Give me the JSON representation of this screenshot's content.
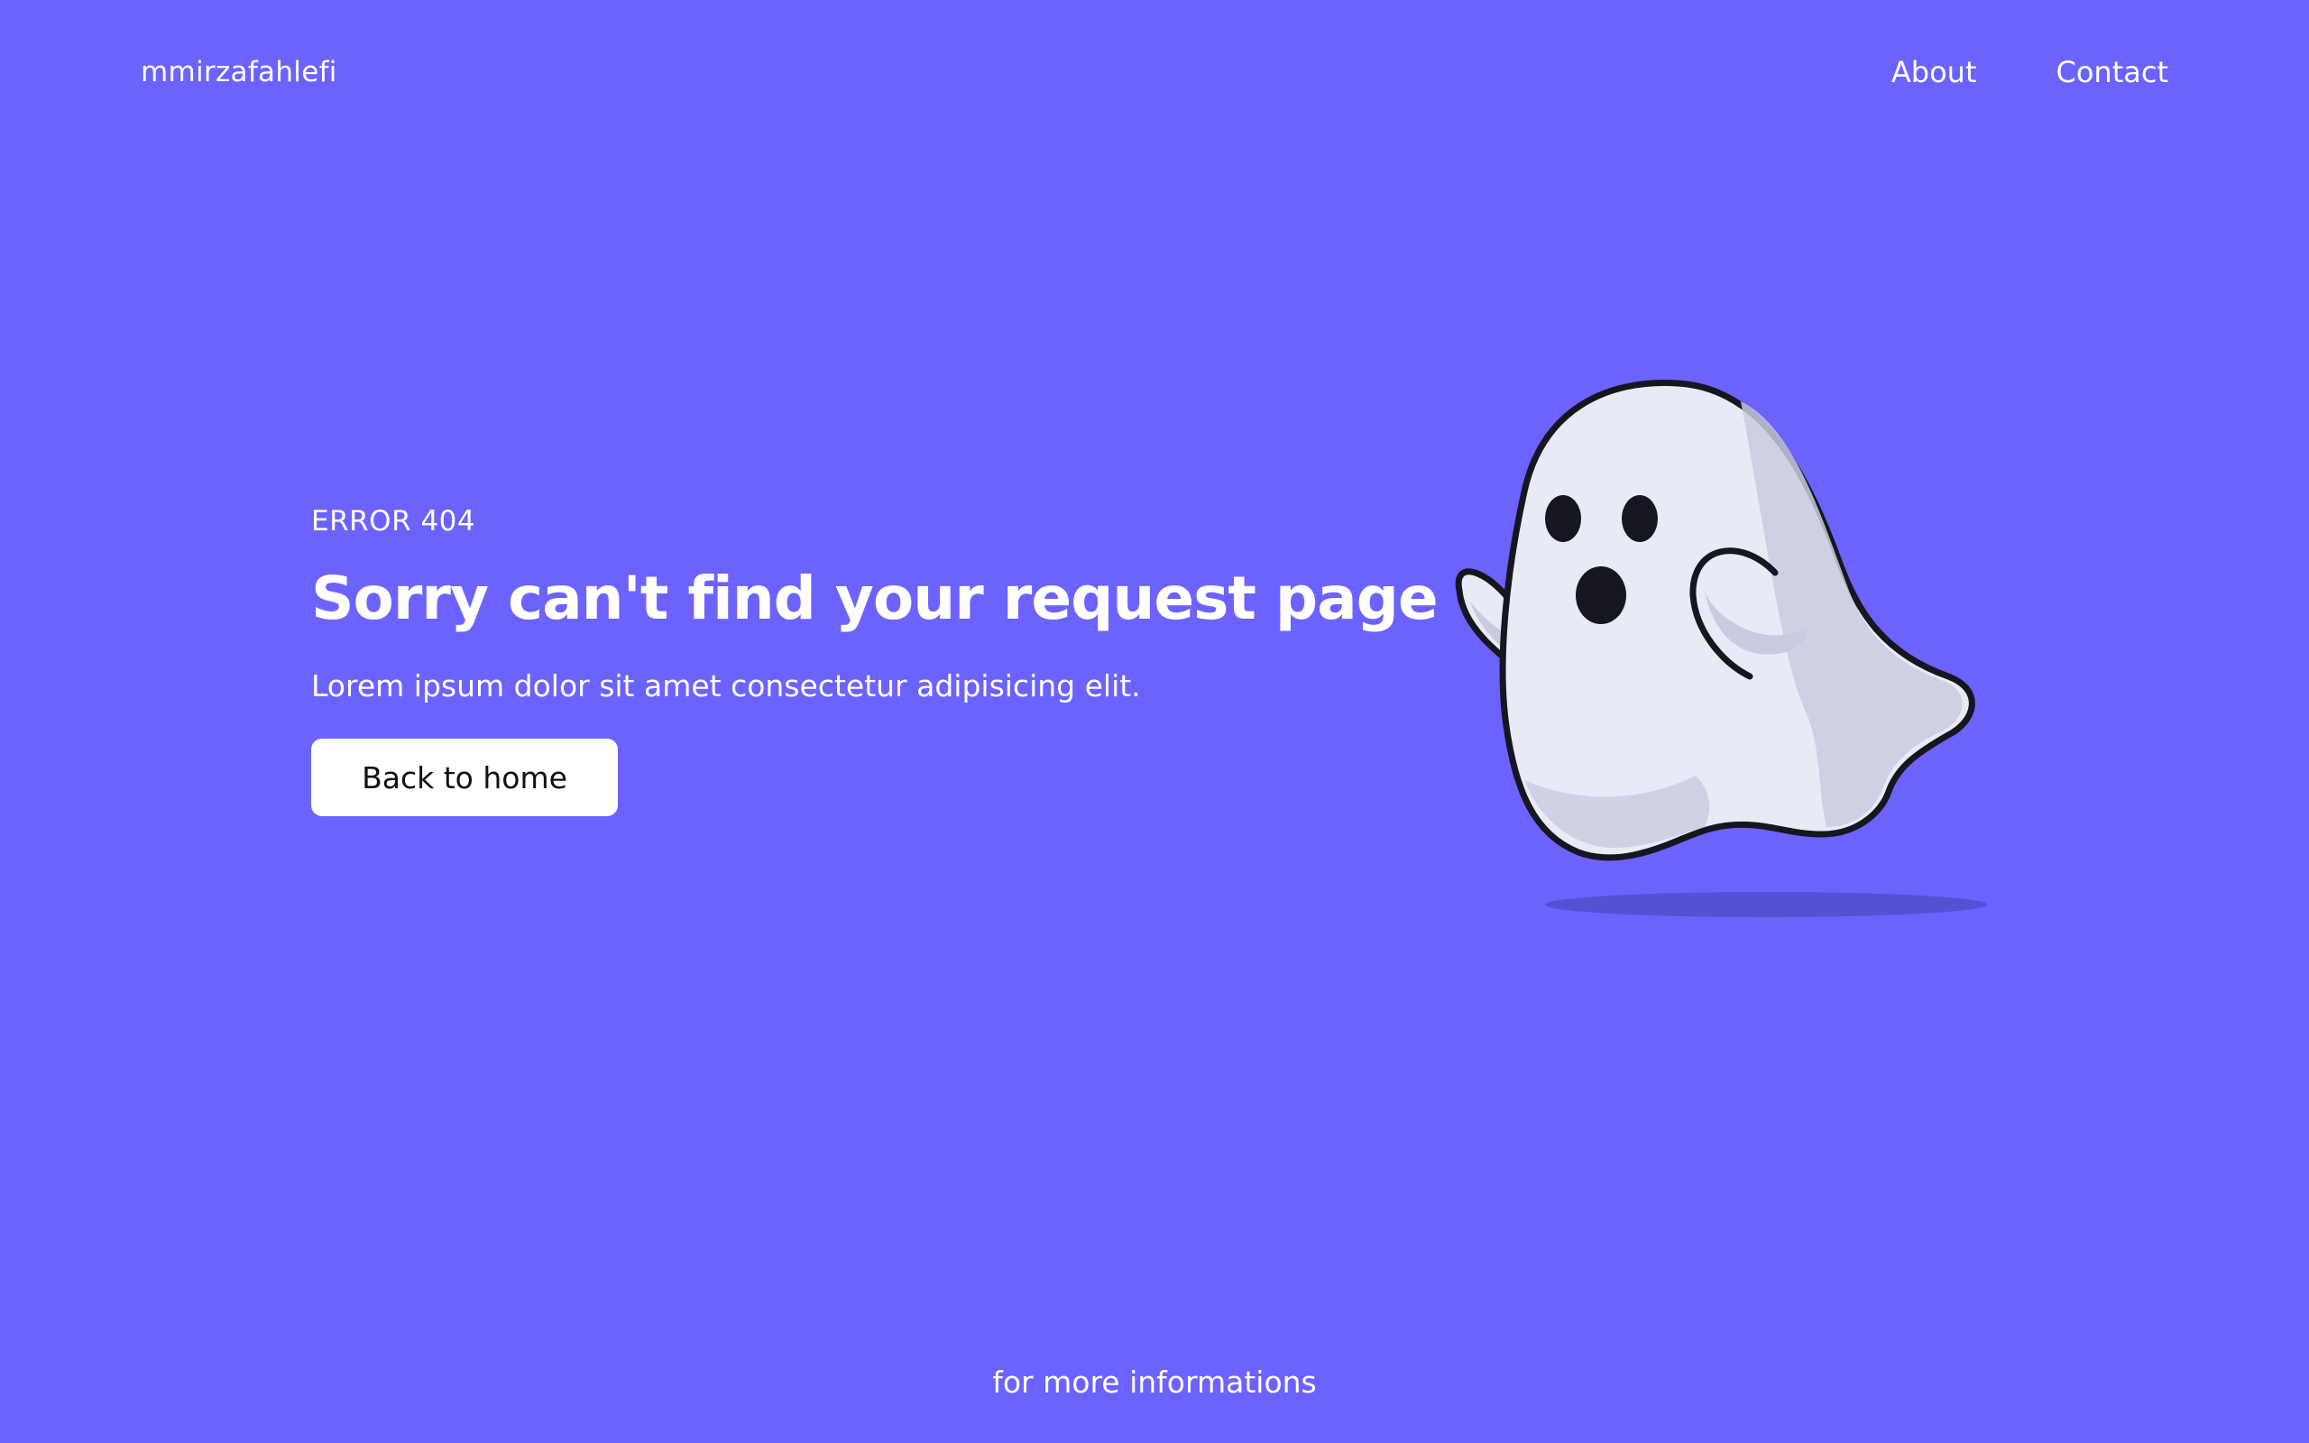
{
  "header": {
    "brand": "mmirzafahlefi",
    "nav": [
      {
        "label": "About"
      },
      {
        "label": "Contact"
      }
    ]
  },
  "main": {
    "eyebrow": "ERROR 404",
    "heading": "Sorry can't find your request page",
    "description": "Lorem ipsum dolor sit amet consectetur adipisicing elit.",
    "button_label": "Back to home",
    "illustration": "ghost-illustration"
  },
  "footer": {
    "link_label": "for more informations"
  },
  "colors": {
    "background": "#6c63ff",
    "text": "#ffffff",
    "button_bg": "#ffffff",
    "button_text": "#111111",
    "ghost_body": "#e8eaf6",
    "ghost_shadow": "#c9cbe0",
    "ghost_outline": "#16161e"
  }
}
